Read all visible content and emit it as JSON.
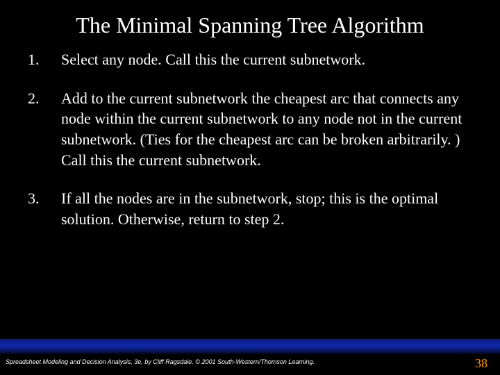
{
  "title": "The Minimal Spanning Tree Algorithm",
  "steps": [
    {
      "num": "1.",
      "text": "Select any node.  Call this the current subnetwork."
    },
    {
      "num": "2.",
      "text": "Add to the current subnetwork the cheapest arc that connects any node within the current subnetwork to any node not in the current subnetwork. (Ties for the cheapest arc can be broken arbitrarily. ) Call this the current subnetwork."
    },
    {
      "num": "3.",
      "text": "If all the nodes are in the subnetwork, stop; this is the optimal solution. Otherwise, return to step 2."
    }
  ],
  "footer": "Spreadsheet Modeling and Decision Analysis, 3e, by Cliff Ragsdale. © 2001 South-Western/Thomson Learning.",
  "page": "38"
}
